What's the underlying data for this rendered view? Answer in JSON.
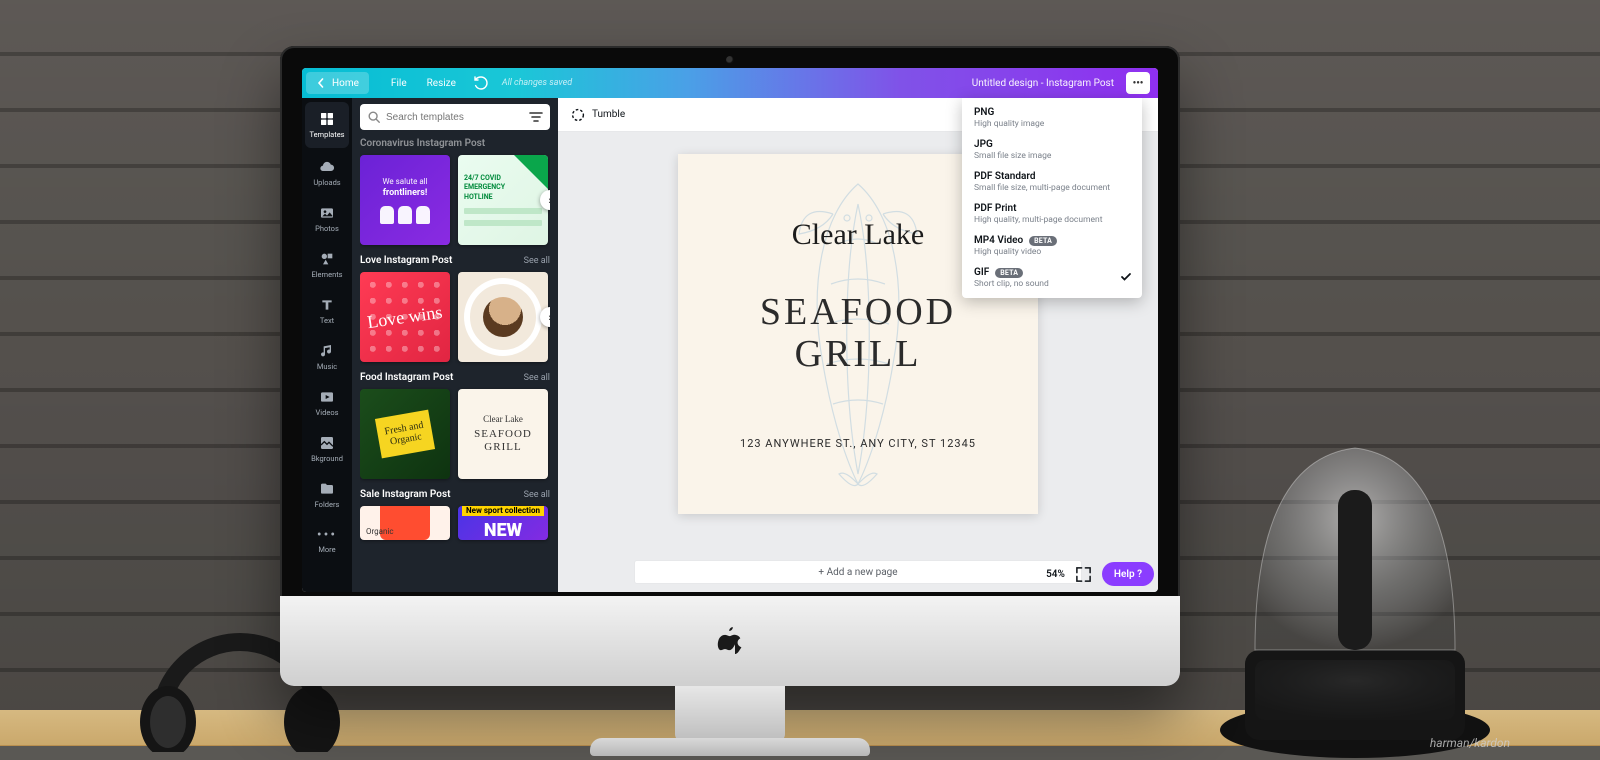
{
  "topbar": {
    "home": "Home",
    "file": "File",
    "resize": "Resize",
    "saved_msg": "All changes saved",
    "doc_title": "Untitled design - Instagram Post",
    "more": "•••"
  },
  "rail": [
    {
      "id": "templates",
      "label": "Templates",
      "active": true
    },
    {
      "id": "uploads",
      "label": "Uploads"
    },
    {
      "id": "photos",
      "label": "Photos"
    },
    {
      "id": "elements",
      "label": "Elements"
    },
    {
      "id": "text",
      "label": "Text"
    },
    {
      "id": "music",
      "label": "Music"
    },
    {
      "id": "videos",
      "label": "Videos"
    },
    {
      "id": "bkground",
      "label": "Bkground"
    },
    {
      "id": "folders",
      "label": "Folders"
    },
    {
      "id": "more",
      "label": "More"
    }
  ],
  "search": {
    "placeholder": "Search templates"
  },
  "panel": {
    "top_section_title": "Coronavirus Instagram Post",
    "groups": [
      {
        "title": "Love Instagram Post",
        "see_all": "See all"
      },
      {
        "title": "Food Instagram Post",
        "see_all": "See all"
      },
      {
        "title": "Sale Instagram Post",
        "see_all": "See all"
      }
    ],
    "covid": {
      "card1_line1": "We salute all",
      "card1_line2": "frontliners!",
      "card2_l1": "24/7 COVID",
      "card2_l2": "EMERGENCY",
      "card2_l3": "HOTLINE"
    },
    "love_card1_text": "Love wins",
    "food": {
      "card1_tag": "Fresh and Organic",
      "card2_script": "Clear Lake",
      "card2_big": "SEAFOOD\nGRILL"
    },
    "sale": {
      "card2_bar": "New sport collection",
      "card2_word": "NEW",
      "card1_word": "Organic"
    }
  },
  "format_bar": {
    "effect_label": "Tumble"
  },
  "artboard": {
    "brand": "Clear Lake",
    "headline_l1": "SEAFOOD",
    "headline_l2": "GRILL",
    "address": "123 ANYWHERE ST., ANY CITY, ST 12345"
  },
  "canvas": {
    "add_page": "+ Add a new page",
    "zoom": "54%",
    "help": "Help  ?"
  },
  "download_menu": [
    {
      "title": "PNG",
      "desc": "High quality image",
      "beta": false,
      "selected": false
    },
    {
      "title": "JPG",
      "desc": "Small file size image",
      "beta": false,
      "selected": false
    },
    {
      "title": "PDF Standard",
      "desc": "Small file size, multi-page document",
      "beta": false,
      "selected": false
    },
    {
      "title": "PDF Print",
      "desc": "High quality, multi-page document",
      "beta": false,
      "selected": false
    },
    {
      "title": "MP4 Video",
      "desc": "High quality video",
      "beta": true,
      "selected": false
    },
    {
      "title": "GIF",
      "desc": "Short clip, no sound",
      "beta": true,
      "selected": true
    }
  ],
  "beta_text": "BETA",
  "speaker_brand": "harman/kardon"
}
